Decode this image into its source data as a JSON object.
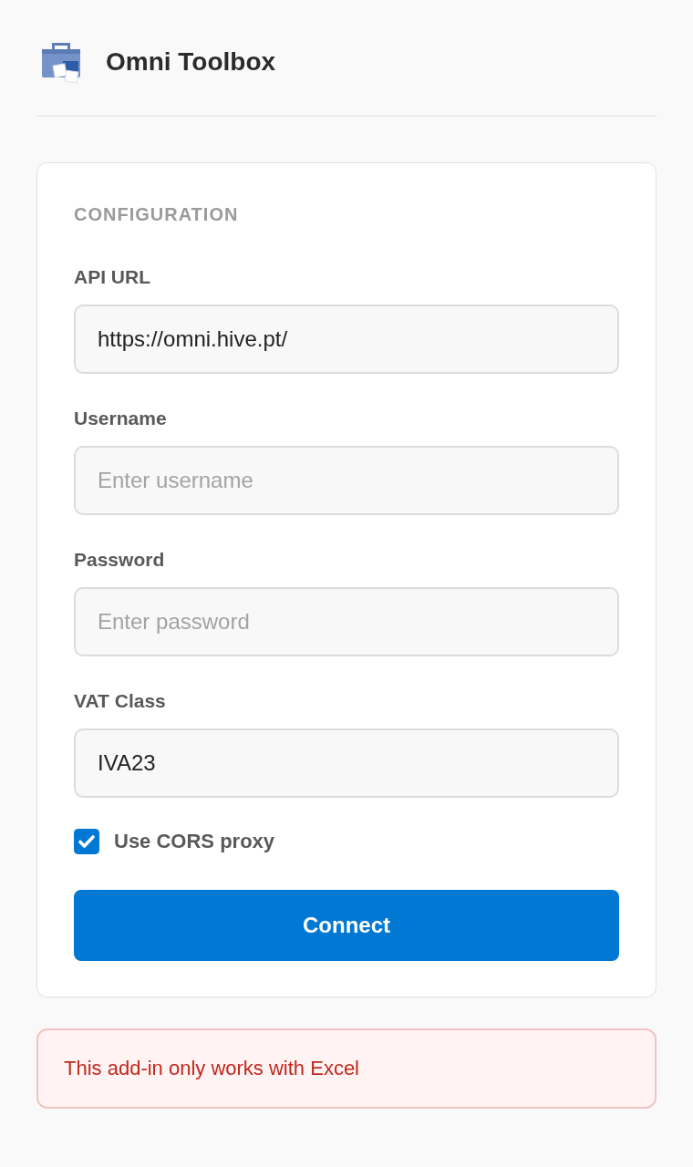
{
  "header": {
    "title": "Omni Toolbox"
  },
  "configuration": {
    "heading": "CONFIGURATION",
    "fields": [
      {
        "label": "API URL",
        "value": "https://omni.hive.pt/"
      },
      {
        "label": "Username",
        "placeholder": "Enter username"
      },
      {
        "label": "Password",
        "placeholder": "Enter password"
      },
      {
        "label": "VAT Class",
        "value": "IVA23"
      }
    ],
    "proxy_option": {
      "label": "Use CORS proxy",
      "checked": true
    },
    "connect_button": {
      "label": "Connect"
    }
  },
  "error_message": {
    "text": "This add-in only works with Excel"
  }
}
